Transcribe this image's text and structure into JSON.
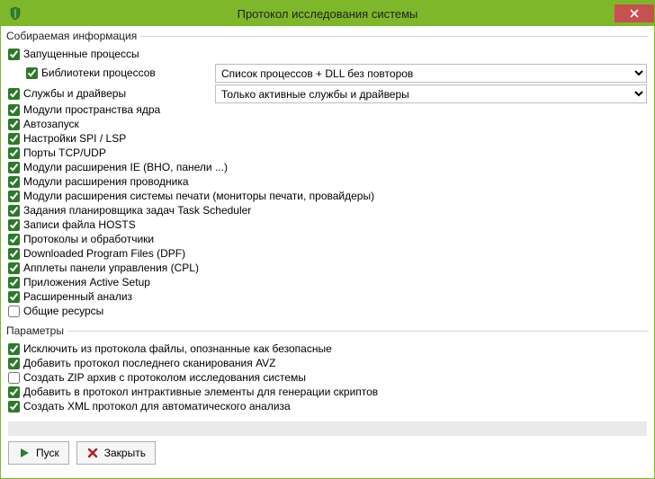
{
  "window": {
    "title": "Протокол исследования системы"
  },
  "group_collect": {
    "legend": "Собираемая информация",
    "running_proc_label": "Запущенные процессы",
    "proc_libs_label": "Библиотеки процессов",
    "combo_proc_value": "Список процессов + DLL без повторов",
    "services_label": "Службы и драйверы",
    "combo_services_value": "Только активные службы и драйверы",
    "items": [
      {
        "label": "Модули пространства ядра",
        "checked": true
      },
      {
        "label": "Автозапуск",
        "checked": true
      },
      {
        "label": "Настройки SPI / LSP",
        "checked": true
      },
      {
        "label": "Порты TCP/UDP",
        "checked": true
      },
      {
        "label": "Модули расширения IE (BHO, панели ...)",
        "checked": true
      },
      {
        "label": "Модули расширения проводника",
        "checked": true
      },
      {
        "label": "Модули расширения системы печати (мониторы печати, провайдеры)",
        "checked": true
      },
      {
        "label": "Задания планировщика задач Task Scheduler",
        "checked": true
      },
      {
        "label": "Записи файла HOSTS",
        "checked": true
      },
      {
        "label": "Протоколы и обработчики",
        "checked": true
      },
      {
        "label": "Downloaded Program Files (DPF)",
        "checked": true
      },
      {
        "label": "Апплеты панели управления (CPL)",
        "checked": true
      },
      {
        "label": "Приложения Active Setup",
        "checked": true
      },
      {
        "label": "Расширенный анализ",
        "checked": true
      },
      {
        "label": "Общие ресурсы",
        "checked": false
      }
    ]
  },
  "group_params": {
    "legend": "Параметры",
    "items": [
      {
        "label": "Исключить из протокола файлы, опознанные как безопасные",
        "checked": true
      },
      {
        "label": "Добавить протокол последнего сканирования AVZ",
        "checked": true
      },
      {
        "label": "Создать ZIP архив с протоколом исследования системы",
        "checked": false
      },
      {
        "label": "Добавить в протокол интрактивные элементы для генерации скриптов",
        "checked": true
      },
      {
        "label": "Создать XML протокол для автоматического анализа",
        "checked": true
      }
    ]
  },
  "buttons": {
    "start": "Пуск",
    "close": "Закрыть"
  }
}
